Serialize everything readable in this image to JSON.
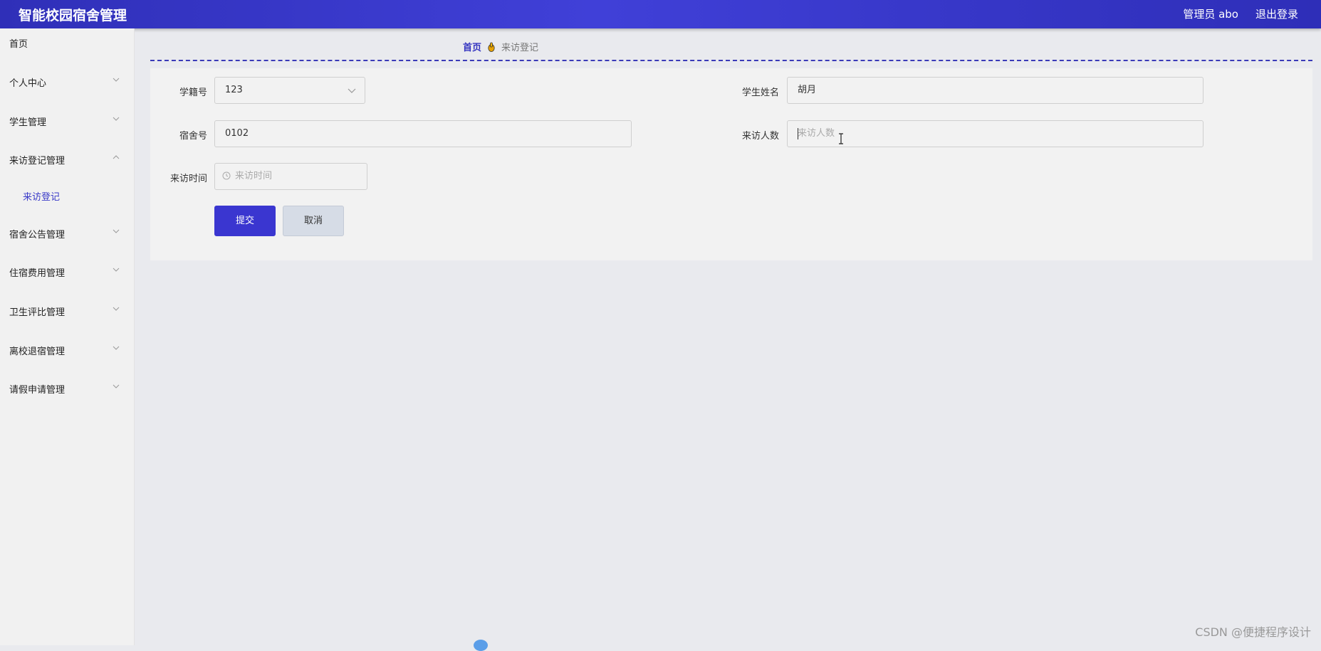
{
  "header": {
    "app_title": "智能校园宿舍管理",
    "user_label": "管理员 abo",
    "logout_label": "退出登录"
  },
  "sidebar": {
    "items": [
      {
        "label": "首页",
        "has_chevron": false
      },
      {
        "label": "个人中心",
        "has_chevron": true,
        "expanded": false
      },
      {
        "label": "学生管理",
        "has_chevron": true,
        "expanded": false
      },
      {
        "label": "来访登记管理",
        "has_chevron": true,
        "expanded": true
      },
      {
        "label": "来访登记",
        "sub": true,
        "active": true
      },
      {
        "label": "宿舍公告管理",
        "has_chevron": true,
        "expanded": false
      },
      {
        "label": "住宿费用管理",
        "has_chevron": true,
        "expanded": false
      },
      {
        "label": "卫生评比管理",
        "has_chevron": true,
        "expanded": false
      },
      {
        "label": "离校退宿管理",
        "has_chevron": true,
        "expanded": false
      },
      {
        "label": "请假申请管理",
        "has_chevron": true,
        "expanded": false
      }
    ]
  },
  "breadcrumb": {
    "home": "首页",
    "current": "来访登记"
  },
  "form": {
    "student_id_label": "学籍号",
    "student_id_value": "123",
    "student_name_label": "学生姓名",
    "student_name_value": "胡月",
    "dorm_label": "宿舍号",
    "dorm_value": "0102",
    "visitor_count_label": "来访人数",
    "visitor_count_placeholder": "来访人数",
    "visit_time_label": "来访时间",
    "visit_time_placeholder": "来访时间",
    "submit_label": "提交",
    "cancel_label": "取消"
  },
  "watermark": "CSDN @便捷程序设计",
  "colors": {
    "header_bg": "#3535c8",
    "accent": "#3a36d0",
    "sidebar_bg": "#f1f1f1",
    "page_bg": "#e9eaee"
  }
}
